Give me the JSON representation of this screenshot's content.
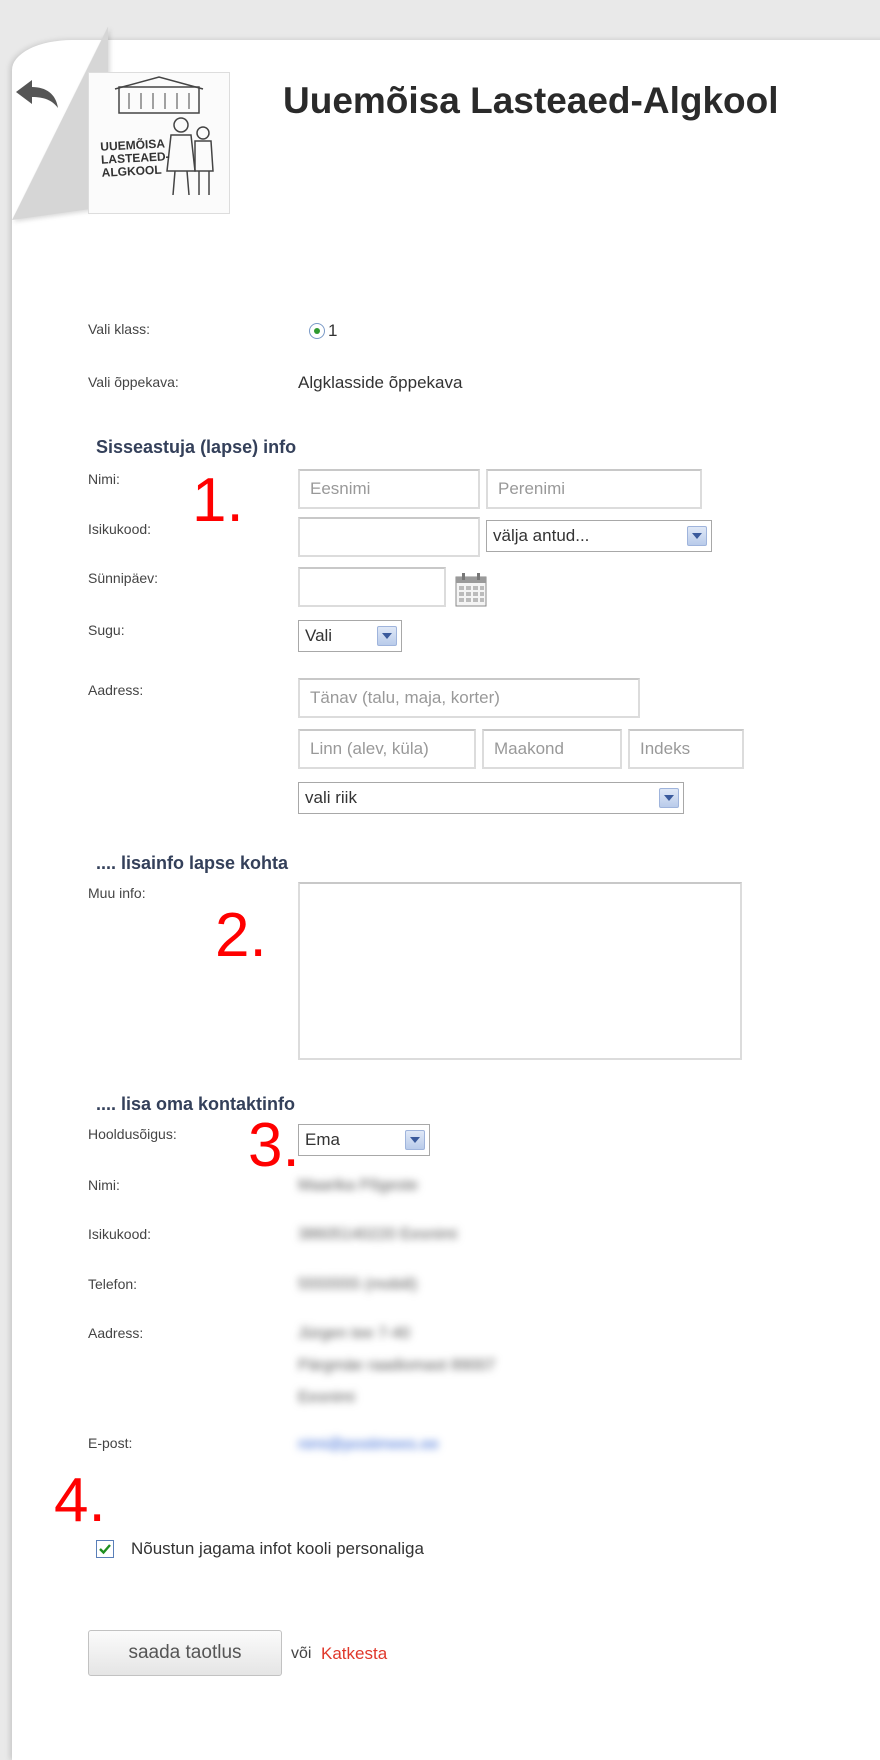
{
  "header": {
    "title": "Uuemõisa Lasteaed-Algkool",
    "logo_text": [
      "UUEMÕISA",
      "LASTEAED-",
      "ALGKOOL"
    ]
  },
  "class_select": {
    "label": "Vali klass:",
    "option": "1"
  },
  "curriculum": {
    "label": "Vali õppekava:",
    "value": "Algklasside õppekava"
  },
  "applicant": {
    "heading": "Sisseastuja (lapse) info",
    "name_label": "Nimi:",
    "first_name_placeholder": "Eesnimi",
    "last_name_placeholder": "Perenimi",
    "id_label": "Isikukood:",
    "issued_by": "välja antud...",
    "birthday_label": "Sünnipäev:",
    "gender_label": "Sugu:",
    "gender_value": "Vali",
    "address_label": "Aadress:",
    "street_placeholder": "Tänav (talu, maja, korter)",
    "city_placeholder": "Linn (alev, küla)",
    "county_placeholder": "Maakond",
    "zip_placeholder": "Indeks",
    "country_value": "vali riik"
  },
  "extra_info": {
    "heading": ".... lisainfo lapse kohta",
    "label": "Muu info:"
  },
  "contact": {
    "heading": ".... lisa oma kontaktinfo",
    "custody_label": "Hooldusõigus:",
    "custody_value": "Ema",
    "name_label": "Nimi:",
    "name_value": "Maarika Põgeste",
    "id_label": "Isikukood:",
    "id_value": "38605140220 Eesnimi",
    "phone_label": "Telefon:",
    "phone_value": "5555555 (mobiil)",
    "address_label": "Aadress:",
    "address_lines": [
      "Jürgen tee 7-40",
      "Pärgmäe raadiomast 89007",
      "Eesnimi"
    ],
    "email_label": "E-post:",
    "email_value": "nimi@postimees.ee"
  },
  "consent": {
    "label": "Nõustun jagama infot kooli personaliga",
    "checked": true
  },
  "actions": {
    "submit_label": "saada taotlus",
    "or_text": "või",
    "cancel_label": "Katkesta"
  },
  "annotations": [
    "1.",
    "2.",
    "3.",
    "4."
  ],
  "colors": {
    "heading": "#34405a",
    "annotation": "#ff0000",
    "cancel_link": "#e0382b"
  }
}
